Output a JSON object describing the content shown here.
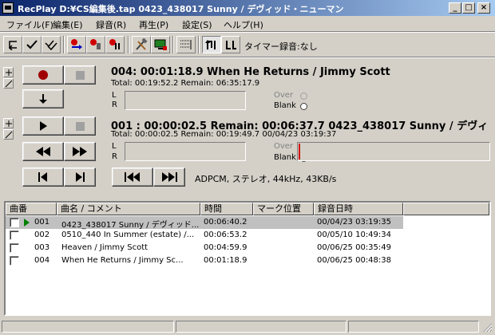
{
  "window": {
    "title": "RecPlay D:¥CS編集後.tap 0423_438017 Sunny / デヴィッド・ニューマン",
    "minimize": "_",
    "maximize": "□",
    "close": "×"
  },
  "menu": [
    "ファイル(F)",
    "編集(E)",
    "録音(R)",
    "再生(P)",
    "設定(S)",
    "ヘルプ(H)"
  ],
  "toolbar": {
    "timer_label": "タイマー録音:なし",
    "icons": [
      "undo-icon",
      "check-icon",
      "double-check-icon",
      "record-a-icon",
      "record-b-icon",
      "record-c-icon",
      "tools-icon",
      "monitor-icon",
      "list-lines-icon",
      "loop-1-icon",
      "loop-2-icon"
    ]
  },
  "recorder": {
    "main_line": "004: 00:01:18.9  When He Returns / Jimmy Scott",
    "sub_line": "Total: 00:19:52.2 Remain: 06:35:17.9",
    "channel_l": "L",
    "channel_r": "R",
    "over_label": "Over",
    "blank_label": "Blank"
  },
  "player": {
    "main_line": "001 : 00:00:02.5  Remain: 00:06:37.7  0423_438017 Sunny / デヴィ",
    "sub_line": "Total: 00:00:02.5   Remain: 00:19:49.7    00/04/23 03:19:37",
    "channel_l": "L",
    "channel_r": "R",
    "over_label": "Over",
    "blank_label": "Blank",
    "format": "ADPCM, ステレオ, 44kHz, 43KB/s",
    "progress": 0.006
  },
  "list": {
    "columns": [
      "曲番",
      "曲名 / コメント",
      "時間",
      "マーク位置",
      "録音日時"
    ],
    "rows": [
      {
        "no": "001",
        "title": "0423_438017 Sunny / デヴィッド...",
        "time": "00:06:40.2",
        "mark": "",
        "date": "00/04/23 03:19:35",
        "selected": true,
        "playing": true
      },
      {
        "no": "002",
        "title": "0510_440 In Summer (estate) /...",
        "time": "00:06:53.2",
        "mark": "",
        "date": "00/05/10 10:49:34",
        "selected": false,
        "playing": false
      },
      {
        "no": "003",
        "title": "Heaven / Jimmy Scott",
        "time": "00:04:59.9",
        "mark": "",
        "date": "00/06/25 00:35:49",
        "selected": false,
        "playing": false
      },
      {
        "no": "004",
        "title": "When He Returns / Jimmy Sc...",
        "time": "00:01:18.9",
        "mark": "",
        "date": "00/06/25 00:48:38",
        "selected": false,
        "playing": false
      }
    ]
  },
  "colors": {
    "titlebar_start": "#0a246a",
    "titlebar_end": "#a6caf0",
    "record": "#a00000",
    "play_mark": "#008000",
    "progress_mark": "#d00000"
  }
}
